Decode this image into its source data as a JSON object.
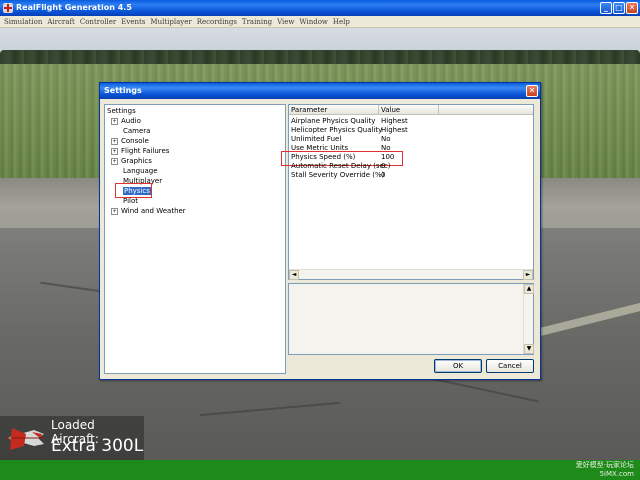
{
  "app": {
    "title": "RealFlight Generation 4.5",
    "window_buttons": [
      "_",
      "□",
      "✕"
    ]
  },
  "menu": {
    "items": [
      "Simulation",
      "Aircraft",
      "Controller",
      "Events",
      "Multiplayer",
      "Recordings",
      "Training",
      "View",
      "Window",
      "Help"
    ]
  },
  "dialog": {
    "title": "Settings",
    "close_glyph": "✕",
    "tree": {
      "root": "Settings",
      "items": [
        {
          "label": "Audio",
          "expander": "+"
        },
        {
          "label": "Camera",
          "expander": ""
        },
        {
          "label": "Console",
          "expander": "+"
        },
        {
          "label": "Flight Failures",
          "expander": "+"
        },
        {
          "label": "Graphics",
          "expander": "+"
        },
        {
          "label": "Language",
          "expander": ""
        },
        {
          "label": "Multiplayer",
          "expander": ""
        },
        {
          "label": "Physics",
          "expander": "",
          "selected": true
        },
        {
          "label": "Pilot",
          "expander": ""
        },
        {
          "label": "Wind and Weather",
          "expander": "+"
        }
      ]
    },
    "grid": {
      "headers": [
        "Parameter",
        "Value"
      ],
      "rows": [
        [
          "Airplane Physics Quality",
          "Highest"
        ],
        [
          "Helicopter Physics Quality",
          "Highest"
        ],
        [
          "Unlimited Fuel",
          "No"
        ],
        [
          "Use Metric Units",
          "No"
        ],
        [
          "Physics Speed (%)",
          "100"
        ],
        [
          "Automatic Reset Delay (sec)",
          "0"
        ],
        [
          "Stall Severity Override (%)",
          "0"
        ]
      ],
      "scroll_left": "◄",
      "scroll_right": "►"
    },
    "description": {
      "scroll_up": "▲",
      "scroll_down": "▼"
    },
    "ok_label": "OK",
    "cancel_label": "Cancel"
  },
  "overlay": {
    "loaded_label": "Loaded Aircraft:",
    "aircraft_name": "Extra 300L"
  },
  "watermark": {
    "line1": "愛好模型·玩家论坛",
    "line2": "5iMX.com"
  },
  "colors": {
    "titlebar": "#0a5ddf",
    "dialog_bg": "#ece9d8",
    "selection": "#316ac5",
    "highlight": "#e03030",
    "statusbar": "#1e8a1a"
  }
}
